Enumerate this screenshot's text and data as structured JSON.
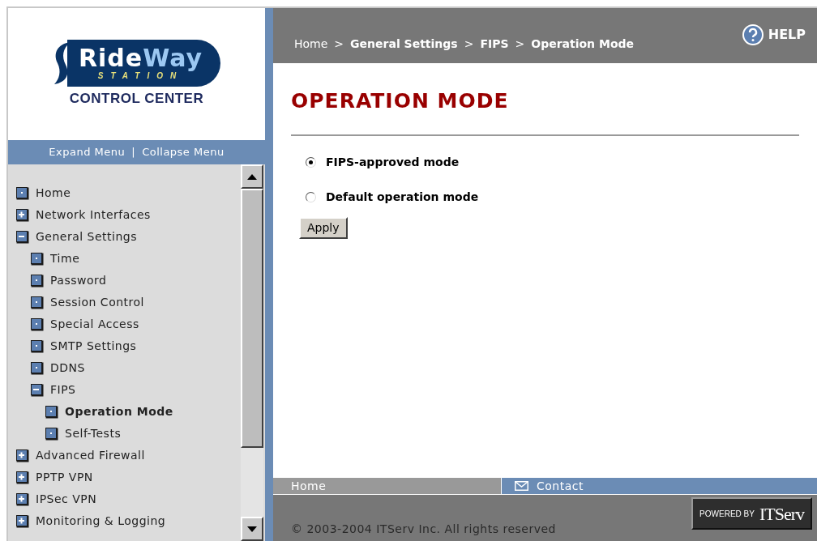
{
  "logo": {
    "word_1": "Ride",
    "word_2": "Way",
    "subtitle": "STATION",
    "caption": "CONTROL CENTER"
  },
  "menu_bar": {
    "expand": "Expand Menu",
    "divider": "|",
    "collapse": "Collapse Menu"
  },
  "tree": [
    {
      "label": "Home",
      "kind": "leaf",
      "selected": false
    },
    {
      "label": "Network Interfaces",
      "kind": "branch",
      "expanded": false,
      "selected": false
    },
    {
      "label": "General Settings",
      "kind": "branch",
      "expanded": true,
      "selected": false,
      "children": [
        {
          "label": "Time",
          "kind": "leaf",
          "selected": false
        },
        {
          "label": "Password",
          "kind": "leaf",
          "selected": false
        },
        {
          "label": "Session Control",
          "kind": "leaf",
          "selected": false
        },
        {
          "label": "Special Access",
          "kind": "leaf",
          "selected": false
        },
        {
          "label": "SMTP Settings",
          "kind": "leaf",
          "selected": false
        },
        {
          "label": "DDNS",
          "kind": "leaf",
          "selected": false
        },
        {
          "label": "FIPS",
          "kind": "branch",
          "expanded": true,
          "selected": false,
          "children": [
            {
              "label": "Operation Mode",
              "kind": "leaf",
              "selected": true
            },
            {
              "label": "Self-Tests",
              "kind": "leaf",
              "selected": false
            }
          ]
        }
      ]
    },
    {
      "label": "Advanced Firewall",
      "kind": "branch",
      "expanded": false,
      "selected": false
    },
    {
      "label": "PPTP VPN",
      "kind": "branch",
      "expanded": false,
      "selected": false
    },
    {
      "label": "IPSec VPN",
      "kind": "branch",
      "expanded": false,
      "selected": false
    },
    {
      "label": "Monitoring & Logging",
      "kind": "branch",
      "expanded": false,
      "selected": false
    }
  ],
  "breadcrumb": {
    "items": [
      "Home",
      "General Settings",
      "FIPS",
      "Operation Mode"
    ],
    "separator": ">"
  },
  "help": "HELP",
  "page_title": "OPERATION MODE",
  "options": [
    {
      "label": "FIPS-approved mode",
      "selected": true
    },
    {
      "label": "Default operation mode",
      "selected": false
    }
  ],
  "apply_button": "Apply",
  "footer_nav": {
    "home": "Home",
    "contact": "Contact"
  },
  "copyright": "© 2003-2004 ITServ Inc. All rights reserved",
  "powered": {
    "prefix": "POWERED BY",
    "brand": "ITServ"
  }
}
